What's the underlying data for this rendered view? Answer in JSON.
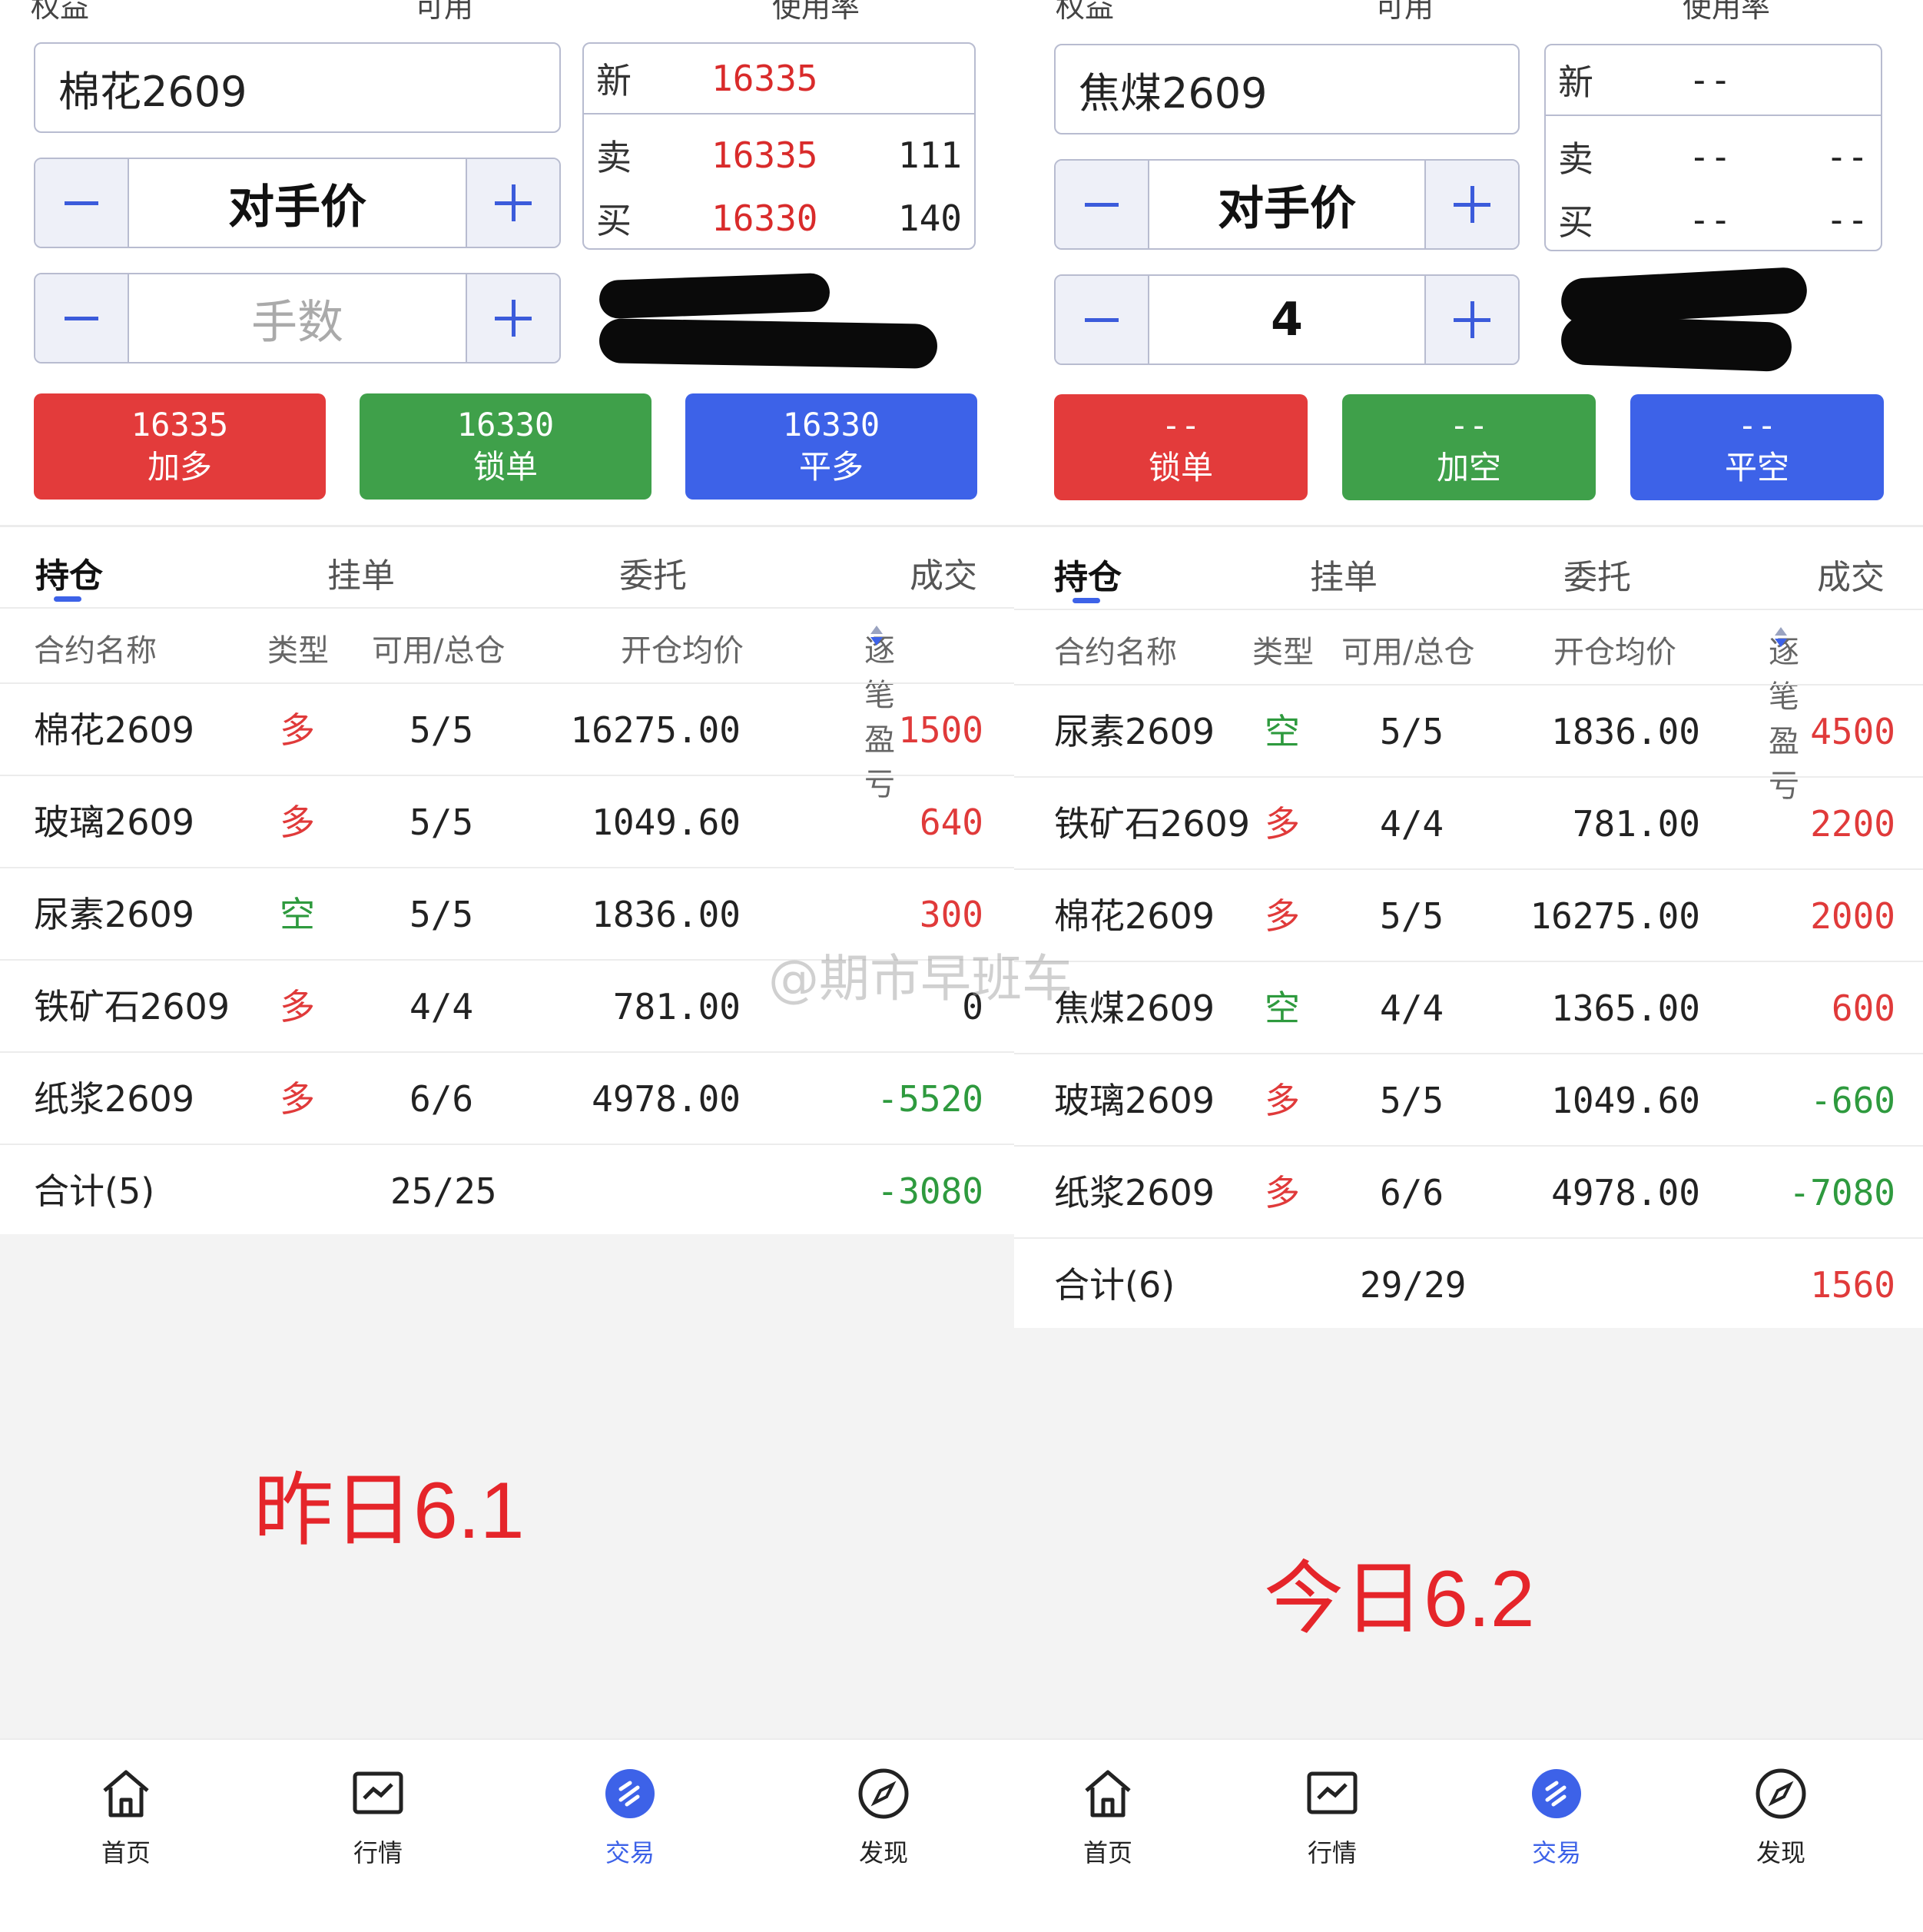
{
  "left": {
    "top_cut": [
      "权益",
      "可用",
      "使用率"
    ],
    "contract_input": "棉花2609",
    "price_stepper": {
      "value": "对手价"
    },
    "qty_stepper": {
      "placeholder": "手数",
      "value": ""
    },
    "quote": {
      "new_label": "新",
      "new_price": "16335",
      "sell_label": "卖",
      "sell_price": "16335",
      "sell_vol": "111",
      "buy_label": "买",
      "buy_price": "16330",
      "buy_vol": "140"
    },
    "buttons": [
      {
        "price": "16335",
        "label": "加多",
        "color": "#e33b3b"
      },
      {
        "price": "16330",
        "label": "锁单",
        "color": "#3fa04a"
      },
      {
        "price": "16330",
        "label": "平多",
        "color": "#3d62e8"
      }
    ],
    "tabs": [
      "持仓",
      "挂单",
      "委托",
      "成交"
    ],
    "headers": [
      "合约名称",
      "类型",
      "可用/总仓",
      "开仓均价",
      "逐笔盈亏"
    ],
    "rows": [
      {
        "name": "棉花2609",
        "type": "多",
        "pos": "5/5",
        "avg": "16275.00",
        "pnl": "1500"
      },
      {
        "name": "玻璃2609",
        "type": "多",
        "pos": "5/5",
        "avg": "1049.60",
        "pnl": "640"
      },
      {
        "name": "尿素2609",
        "type": "空",
        "pos": "5/5",
        "avg": "1836.00",
        "pnl": "300"
      },
      {
        "name": "铁矿石2609",
        "type": "多",
        "pos": "4/4",
        "avg": "781.00",
        "pnl": "0"
      },
      {
        "name": "纸浆2609",
        "type": "多",
        "pos": "6/6",
        "avg": "4978.00",
        "pnl": "-5520"
      }
    ],
    "total": {
      "label": "合计(5)",
      "pos": "25/25",
      "pnl": "-3080"
    },
    "annotation": "昨日6.1"
  },
  "right": {
    "top_cut": [
      "权益",
      "可用",
      "使用率"
    ],
    "contract_input": "焦煤2609",
    "price_stepper": {
      "value": "对手价"
    },
    "qty_stepper": {
      "placeholder": "手数",
      "value": "4"
    },
    "quote": {
      "new_label": "新",
      "new_price": "--",
      "sell_label": "卖",
      "sell_price": "--",
      "sell_vol": "--",
      "buy_label": "买",
      "buy_price": "--",
      "buy_vol": "--"
    },
    "buttons": [
      {
        "price": "--",
        "label": "锁单",
        "color": "#e33b3b"
      },
      {
        "price": "--",
        "label": "加空",
        "color": "#3fa04a"
      },
      {
        "price": "--",
        "label": "平空",
        "color": "#3d62e8"
      }
    ],
    "tabs": [
      "持仓",
      "挂单",
      "委托",
      "成交"
    ],
    "headers": [
      "合约名称",
      "类型",
      "可用/总仓",
      "开仓均价",
      "逐笔盈亏"
    ],
    "rows": [
      {
        "name": "尿素2609",
        "type": "空",
        "pos": "5/5",
        "avg": "1836.00",
        "pnl": "4500"
      },
      {
        "name": "铁矿石2609",
        "type": "多",
        "pos": "4/4",
        "avg": "781.00",
        "pnl": "2200"
      },
      {
        "name": "棉花2609",
        "type": "多",
        "pos": "5/5",
        "avg": "16275.00",
        "pnl": "2000"
      },
      {
        "name": "焦煤2609",
        "type": "空",
        "pos": "4/4",
        "avg": "1365.00",
        "pnl": "600"
      },
      {
        "name": "玻璃2609",
        "type": "多",
        "pos": "5/5",
        "avg": "1049.60",
        "pnl": "-660"
      },
      {
        "name": "纸浆2609",
        "type": "多",
        "pos": "6/6",
        "avg": "4978.00",
        "pnl": "-7080"
      }
    ],
    "total": {
      "label": "合计(6)",
      "pos": "29/29",
      "pnl": "1560"
    },
    "annotation": "今日6.2"
  },
  "nav": [
    {
      "label": "首页",
      "icon": "home-icon"
    },
    {
      "label": "行情",
      "icon": "chart-icon"
    },
    {
      "label": "交易",
      "icon": "trade-icon",
      "active": true
    },
    {
      "label": "发现",
      "icon": "compass-icon"
    }
  ],
  "watermark": "@期市早班车",
  "colors": {
    "red": "#e33b3b",
    "green": "#3fa04a",
    "blue": "#3d62e8"
  }
}
